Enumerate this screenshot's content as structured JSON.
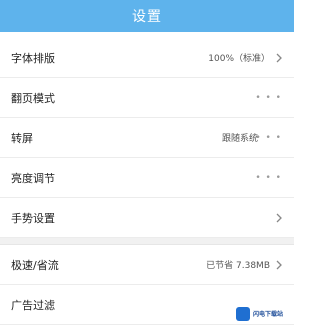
{
  "header": {
    "title": "设置"
  },
  "settings": [
    {
      "label": "字体排版",
      "value": "100%（标准）",
      "has_chevron": true
    },
    {
      "label": "翻页模式",
      "value": "",
      "has_chevron": false,
      "trailing_icon": "more-dots-icon"
    },
    {
      "label": "转屏",
      "value": "跟随系统",
      "has_chevron": false,
      "trailing_icon": "more-dots-icon"
    },
    {
      "label": "亮度调节",
      "value": "",
      "has_chevron": false,
      "trailing_icon": "more-dots-icon"
    },
    {
      "label": "手势设置",
      "value": "",
      "has_chevron": true
    },
    {
      "label": "极速/省流",
      "value": "已节省 7.38MB",
      "has_chevron": true
    },
    {
      "label": "广告过滤",
      "value": "",
      "has_chevron": false
    }
  ],
  "watermark": {
    "text": "闪电下载站"
  },
  "colors": {
    "header_bg": "#5eb3ec",
    "divider": "#ececec",
    "section_gap": "#f1f1f1"
  }
}
